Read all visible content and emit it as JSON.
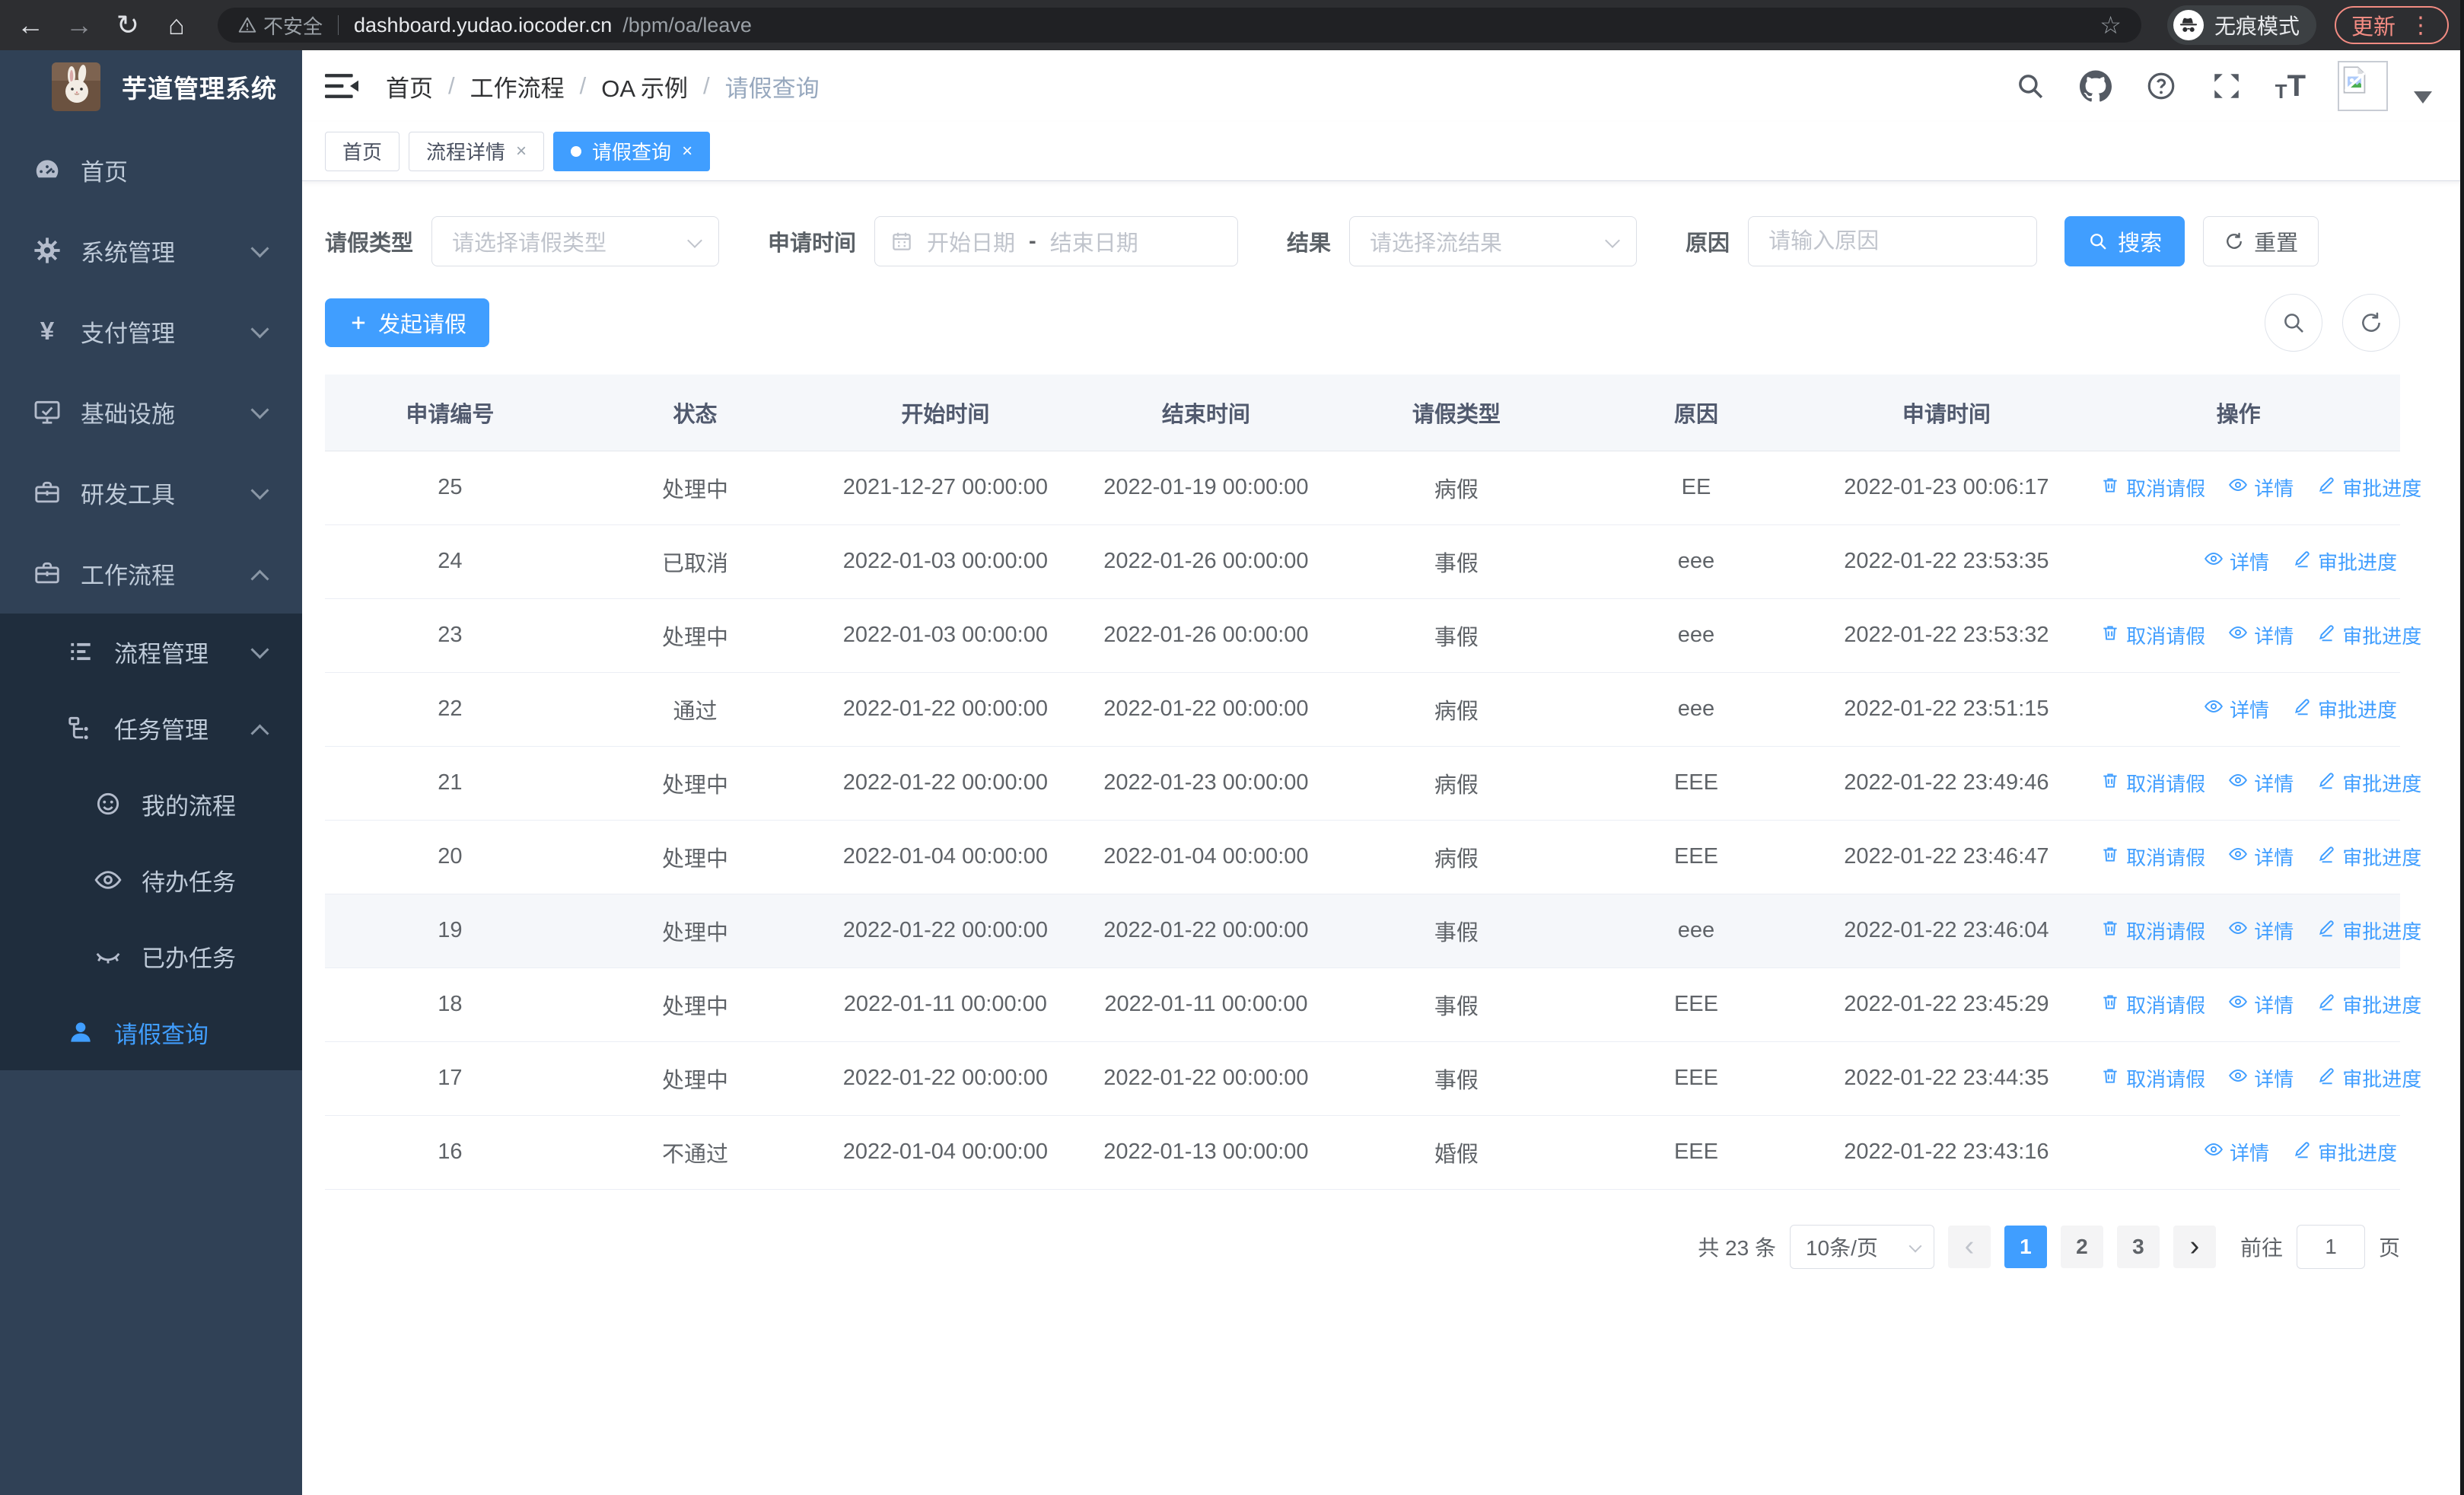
{
  "browser": {
    "security_label": "不安全",
    "url_host": "dashboard.yudao.iocoder.cn",
    "url_path": "/bpm/oa/leave",
    "incognito_label": "无痕模式",
    "update_label": "更新"
  },
  "sidebar": {
    "title": "芋道管理系统",
    "items": [
      {
        "key": "home",
        "label": "首页",
        "icon": "dashboard-icon",
        "level": 1,
        "chevron": "none",
        "active": false
      },
      {
        "key": "system",
        "label": "系统管理",
        "icon": "gear-icon",
        "level": 1,
        "chevron": "down",
        "active": false
      },
      {
        "key": "payment",
        "label": "支付管理",
        "icon": "yen-icon",
        "level": 1,
        "chevron": "down",
        "active": false
      },
      {
        "key": "infra",
        "label": "基础设施",
        "icon": "monitor-icon",
        "level": 1,
        "chevron": "down",
        "active": false
      },
      {
        "key": "devtools",
        "label": "研发工具",
        "icon": "toolbox-icon",
        "level": 1,
        "chevron": "down",
        "active": false
      },
      {
        "key": "workflow",
        "label": "工作流程",
        "icon": "toolbox-icon",
        "level": 1,
        "chevron": "up",
        "active": false
      },
      {
        "key": "process-mgmt",
        "label": "流程管理",
        "icon": "list-icon",
        "level": 2,
        "chevron": "down",
        "active": false
      },
      {
        "key": "task-mgmt",
        "label": "任务管理",
        "icon": "tree-icon",
        "level": 2,
        "chevron": "up",
        "active": false
      },
      {
        "key": "my-process",
        "label": "我的流程",
        "icon": "face-icon",
        "level": 3,
        "chevron": "none",
        "active": false
      },
      {
        "key": "todo-tasks",
        "label": "待办任务",
        "icon": "eye-open-icon",
        "level": 3,
        "chevron": "none",
        "active": false
      },
      {
        "key": "done-tasks",
        "label": "已办任务",
        "icon": "eye-closed-icon",
        "level": 3,
        "chevron": "none",
        "active": false
      },
      {
        "key": "leave-query",
        "label": "请假查询",
        "icon": "user-icon",
        "level": 2,
        "chevron": "none",
        "active": true
      }
    ]
  },
  "header": {
    "breadcrumb": [
      "首页",
      "工作流程",
      "OA 示例",
      "请假查询"
    ],
    "tabs": [
      {
        "key": "home",
        "label": "首页",
        "active": false,
        "closable": false
      },
      {
        "key": "process-detail",
        "label": "流程详情",
        "active": false,
        "closable": true
      },
      {
        "key": "leave-query",
        "label": "请假查询",
        "active": true,
        "closable": true
      }
    ]
  },
  "filters": {
    "leave_type_label": "请假类型",
    "leave_type_placeholder": "请选择请假类型",
    "apply_time_label": "申请时间",
    "start_date_placeholder": "开始日期",
    "date_separator": "-",
    "end_date_placeholder": "结束日期",
    "result_label": "结果",
    "result_placeholder": "请选择流结果",
    "reason_label": "原因",
    "reason_placeholder": "请输入原因",
    "search_label": "搜索",
    "reset_label": "重置"
  },
  "toolbar": {
    "create_label": "发起请假"
  },
  "table": {
    "headers": [
      "申请编号",
      "状态",
      "开始时间",
      "结束时间",
      "请假类型",
      "原因",
      "申请时间",
      "操作"
    ],
    "action_labels": {
      "cancel": "取消请假",
      "detail": "详情",
      "progress": "审批进度"
    },
    "rows": [
      {
        "id": "25",
        "status": "处理中",
        "start": "2021-12-27 00:00:00",
        "end": "2022-01-19 00:00:00",
        "type": "病假",
        "reason": "EE",
        "applied": "2022-01-23 00:06:17",
        "actions": [
          "cancel",
          "detail",
          "progress"
        ],
        "highlight": false
      },
      {
        "id": "24",
        "status": "已取消",
        "start": "2022-01-03 00:00:00",
        "end": "2022-01-26 00:00:00",
        "type": "事假",
        "reason": "eee",
        "applied": "2022-01-22 23:53:35",
        "actions": [
          "detail",
          "progress"
        ],
        "highlight": false
      },
      {
        "id": "23",
        "status": "处理中",
        "start": "2022-01-03 00:00:00",
        "end": "2022-01-26 00:00:00",
        "type": "事假",
        "reason": "eee",
        "applied": "2022-01-22 23:53:32",
        "actions": [
          "cancel",
          "detail",
          "progress"
        ],
        "highlight": false
      },
      {
        "id": "22",
        "status": "通过",
        "start": "2022-01-22 00:00:00",
        "end": "2022-01-22 00:00:00",
        "type": "病假",
        "reason": "eee",
        "applied": "2022-01-22 23:51:15",
        "actions": [
          "detail",
          "progress"
        ],
        "highlight": false
      },
      {
        "id": "21",
        "status": "处理中",
        "start": "2022-01-22 00:00:00",
        "end": "2022-01-23 00:00:00",
        "type": "病假",
        "reason": "EEE",
        "applied": "2022-01-22 23:49:46",
        "actions": [
          "cancel",
          "detail",
          "progress"
        ],
        "highlight": false
      },
      {
        "id": "20",
        "status": "处理中",
        "start": "2022-01-04 00:00:00",
        "end": "2022-01-04 00:00:00",
        "type": "病假",
        "reason": "EEE",
        "applied": "2022-01-22 23:46:47",
        "actions": [
          "cancel",
          "detail",
          "progress"
        ],
        "highlight": false
      },
      {
        "id": "19",
        "status": "处理中",
        "start": "2022-01-22 00:00:00",
        "end": "2022-01-22 00:00:00",
        "type": "事假",
        "reason": "eee",
        "applied": "2022-01-22 23:46:04",
        "actions": [
          "cancel",
          "detail",
          "progress"
        ],
        "highlight": true
      },
      {
        "id": "18",
        "status": "处理中",
        "start": "2022-01-11 00:00:00",
        "end": "2022-01-11 00:00:00",
        "type": "事假",
        "reason": "EEE",
        "applied": "2022-01-22 23:45:29",
        "actions": [
          "cancel",
          "detail",
          "progress"
        ],
        "highlight": false
      },
      {
        "id": "17",
        "status": "处理中",
        "start": "2022-01-22 00:00:00",
        "end": "2022-01-22 00:00:00",
        "type": "事假",
        "reason": "EEE",
        "applied": "2022-01-22 23:44:35",
        "actions": [
          "cancel",
          "detail",
          "progress"
        ],
        "highlight": false
      },
      {
        "id": "16",
        "status": "不通过",
        "start": "2022-01-04 00:00:00",
        "end": "2022-01-13 00:00:00",
        "type": "婚假",
        "reason": "EEE",
        "applied": "2022-01-22 23:43:16",
        "actions": [
          "detail",
          "progress"
        ],
        "highlight": false
      }
    ]
  },
  "pagination": {
    "total_label": "共 23 条",
    "page_size": "10条/页",
    "pages": [
      "1",
      "2",
      "3"
    ],
    "active_page": "1",
    "prev_symbol": "‹",
    "next_symbol": "›",
    "goto_label": "前往",
    "goto_value": "1",
    "goto_suffix": "页"
  },
  "colors": {
    "accent": "#409eff",
    "sidebar_bg": "#304156",
    "submenu_bg": "#1f2d3d",
    "update_chip": "#f28b82"
  }
}
